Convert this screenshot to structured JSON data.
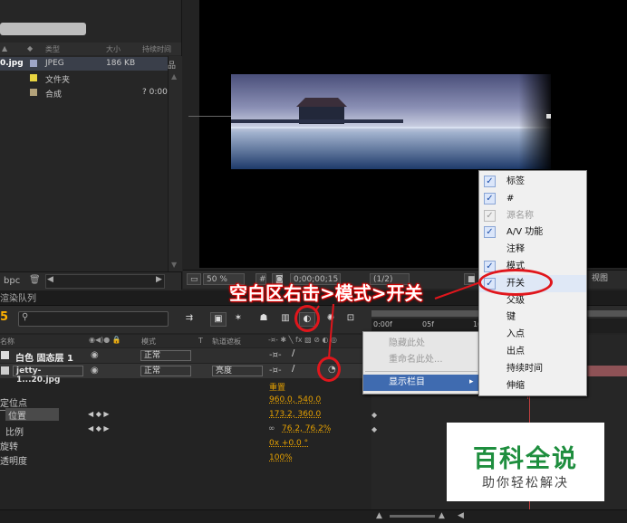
{
  "project": {
    "columns": {
      "type": "类型",
      "size": "大小",
      "duration": "持续时间"
    },
    "rows": [
      {
        "name": "0.jpg",
        "type": "JPEG",
        "size": "186 KB",
        "duration": "",
        "color": "#9ea6c8"
      },
      {
        "name": "",
        "type": "文件夹",
        "size": "",
        "duration": "",
        "color": "#e8d440"
      },
      {
        "name": "",
        "type": "合成",
        "size": "",
        "duration": "? 0:00",
        "color": "#b3a27a"
      }
    ],
    "footer_bpc": "bpc"
  },
  "viewer": {
    "zoom": "50 %",
    "timecode": "0;00;00;15",
    "resolution": "(1/2)",
    "view_label": "视图"
  },
  "timeline": {
    "tab_label": "渲染队列",
    "time_digit": "5",
    "search_placeholder": "",
    "ruler": {
      "t0": "0:00f",
      "t1": "05f",
      "t2": "10"
    },
    "columns": {
      "layer_name": "名称",
      "mode": "模式",
      "t": "T",
      "trkmat": "轨道遮板",
      "parent": "父级"
    },
    "layers": [
      {
        "name": "白色 固态层 1",
        "mode": "正常",
        "trkmat": ""
      },
      {
        "name": "jetty-1...20.jpg",
        "mode": "正常",
        "trkmat": "亮度"
      }
    ],
    "reset_label": "重置",
    "properties": [
      {
        "name": "定位点",
        "value": "960.0, 540.0"
      },
      {
        "name": "位置",
        "value": "173.2, 360.0"
      },
      {
        "name": "比例",
        "value": "76.2, 76.2%"
      },
      {
        "name": "旋转",
        "value": "0x +0.0 °"
      },
      {
        "name": "透明度",
        "value": "100%"
      }
    ]
  },
  "context_menu": {
    "items": [
      {
        "label": "隐藏此处",
        "enabled": false
      },
      {
        "label": "重命名此处...",
        "enabled": false
      },
      {
        "label": "显示栏目",
        "enabled": true,
        "highlighted": true,
        "arrow": "▸"
      }
    ]
  },
  "submenu": {
    "items": [
      {
        "label": "标签",
        "checked": true,
        "enabled": true
      },
      {
        "label": "#",
        "checked": true,
        "enabled": true
      },
      {
        "label": "源名称",
        "checked": true,
        "enabled": false
      },
      {
        "label": "A/V 功能",
        "checked": true,
        "enabled": true
      },
      {
        "label": "注释",
        "checked": false,
        "enabled": true
      },
      {
        "label": "模式",
        "checked": true,
        "enabled": true
      },
      {
        "label": "开关",
        "checked": true,
        "enabled": true,
        "highlighted": true
      },
      {
        "label": "父级",
        "checked": false,
        "enabled": true
      },
      {
        "label": "键",
        "checked": false,
        "enabled": true
      },
      {
        "label": "入点",
        "checked": false,
        "enabled": true
      },
      {
        "label": "出点",
        "checked": false,
        "enabled": true
      },
      {
        "label": "持续时间",
        "checked": false,
        "enabled": true
      },
      {
        "label": "伸缩",
        "checked": false,
        "enabled": true
      }
    ]
  },
  "annotation": {
    "text": "空白区右击>模式>开关",
    "color": "#e0161c"
  },
  "watermark": {
    "title": "百科全说",
    "subtitle": "助你轻松解决"
  }
}
